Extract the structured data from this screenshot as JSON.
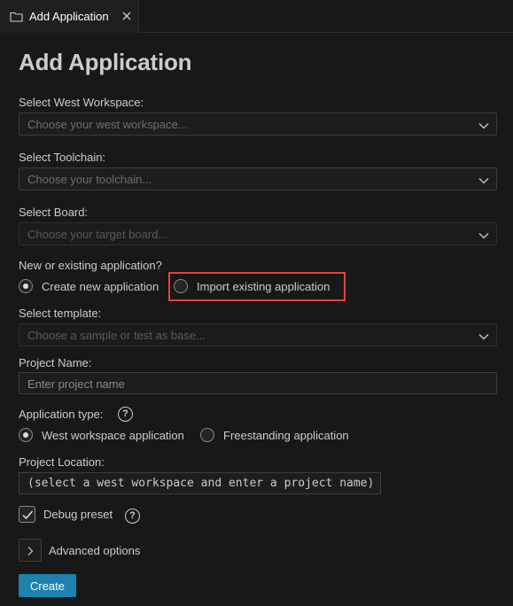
{
  "tab": {
    "label": "Add Application",
    "icon": "folder-icon"
  },
  "form": {
    "title": "Add Application",
    "workspace": {
      "label": "Select West Workspace:",
      "placeholder": "Choose your west workspace..."
    },
    "toolchain": {
      "label": "Select Toolchain:",
      "placeholder": "Choose your toolchain..."
    },
    "board": {
      "label": "Select Board:",
      "placeholder": "Choose your target board..."
    },
    "new_or_existing": {
      "label": "New or existing application?",
      "options": [
        "Create new application",
        "Import existing application"
      ],
      "selected": "Create new application"
    },
    "template": {
      "label": "Select template:",
      "placeholder": "Choose a sample or test as base..."
    },
    "project_name": {
      "label": "Project Name:",
      "placeholder": "Enter project name"
    },
    "app_type": {
      "label": "Application type:",
      "help": "?",
      "options": [
        "West workspace application",
        "Freestanding application"
      ],
      "selected": "West workspace application"
    },
    "location": {
      "label": "Project Location:",
      "value": "(select a west workspace and enter a project name)"
    },
    "debug_preset": {
      "label": "Debug preset",
      "checked": true,
      "help": "?"
    },
    "advanced": {
      "label": "Advanced options"
    },
    "create_label": "Create"
  },
  "colors": {
    "accent": "#1d82ad",
    "highlight": "#e0433b",
    "background": "#181818"
  }
}
